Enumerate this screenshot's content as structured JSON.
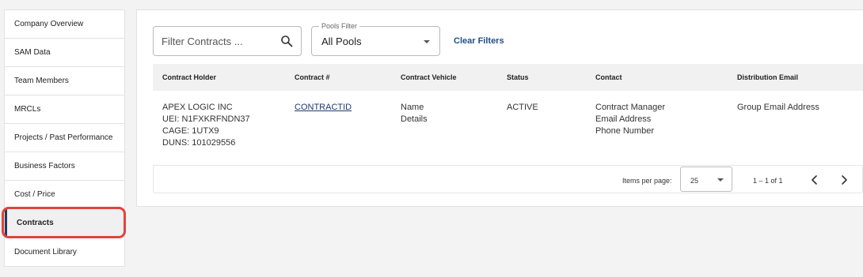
{
  "sidebar": {
    "items": [
      {
        "label": "Company Overview"
      },
      {
        "label": "SAM Data"
      },
      {
        "label": "Team Members"
      },
      {
        "label": "MRCLs"
      },
      {
        "label": "Projects / Past Performance"
      },
      {
        "label": "Business Factors"
      },
      {
        "label": "Cost / Price"
      },
      {
        "label": "Contracts",
        "active": true
      },
      {
        "label": "Document Library"
      }
    ],
    "highlight_color": "#e0453a"
  },
  "filters": {
    "search_placeholder": "Filter Contracts ...",
    "search_icon": "search-icon",
    "pools_label": "Pools Filter",
    "pools_value": "All Pools",
    "clear_label": "Clear Filters"
  },
  "table": {
    "headers": [
      "Contract Holder",
      "Contract #",
      "Contract Vehicle",
      "Status",
      "Contact",
      "Distribution Email"
    ],
    "rows": [
      {
        "holder": [
          "APEX LOGIC INC",
          "UEI: N1FXKRFNDN37",
          "CAGE: 1UTX9",
          "DUNS: 101029556"
        ],
        "contract_number": "CONTRACTID",
        "vehicle": [
          "Name",
          "Details"
        ],
        "status": "ACTIVE",
        "contact": [
          "Contract Manager",
          "Email Address",
          "Phone Number"
        ],
        "distribution_email": "Group Email Address"
      }
    ]
  },
  "paginator": {
    "items_per_page_label": "Items per page:",
    "items_per_page_value": "25",
    "range_label": "1 – 1 of 1"
  },
  "colors": {
    "link": "#1f3a70",
    "accent": "#1f4f8a"
  }
}
